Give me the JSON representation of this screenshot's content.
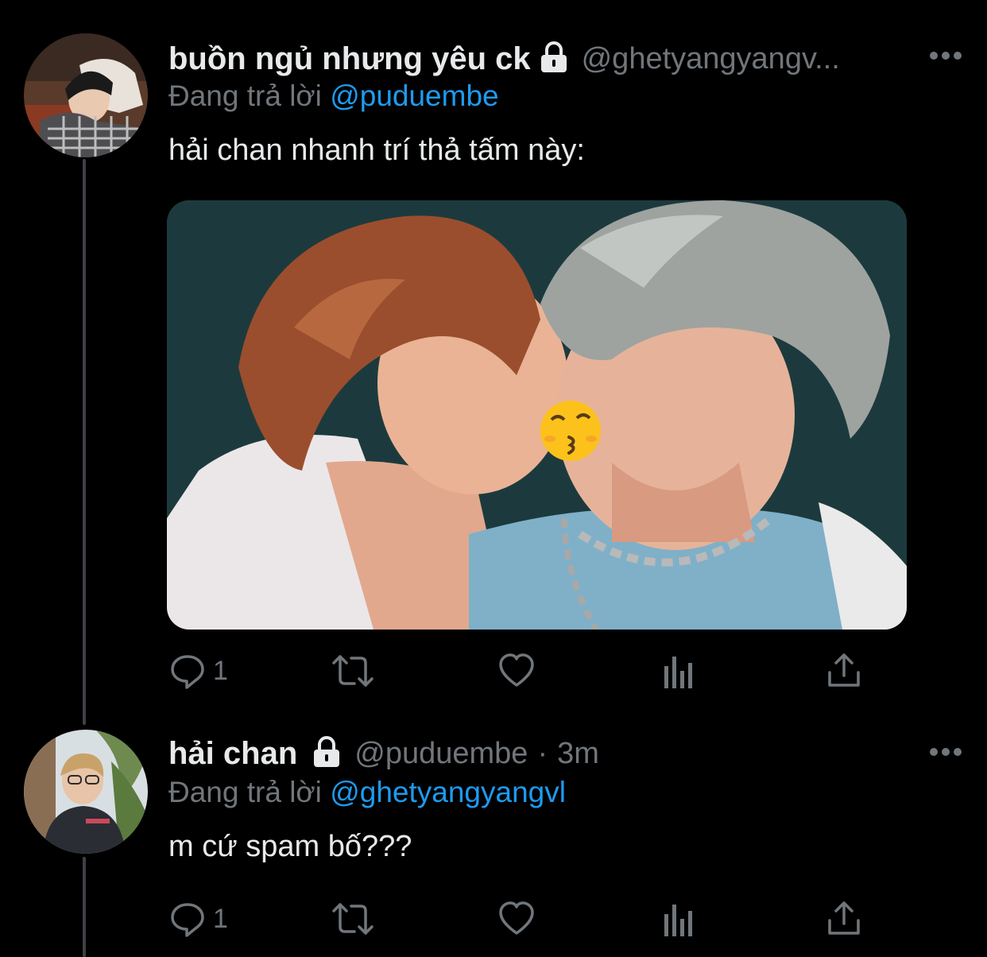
{
  "colors": {
    "background": "#000000",
    "text_primary": "#e7e9ea",
    "text_secondary": "#71767b",
    "link": "#1d9bf0",
    "thread_line": "#3e4144"
  },
  "tweets": [
    {
      "display_name": "buồn ngủ nhưng yêu ck",
      "handle": "@ghetyangyangv...",
      "protected_icon": "lock-icon",
      "replying_prefix": "Đang trả lời",
      "replying_to": "@puduembe",
      "text": "hải chan nhanh trí thả tấm này:",
      "has_media": true,
      "media_emoji": "😚",
      "actions": {
        "reply_count": "1",
        "retweet_count": "",
        "like_count": ""
      }
    },
    {
      "display_name": "hải chan",
      "handle": "@puduembe",
      "separator": "·",
      "timestamp": "3m",
      "protected_icon": "lock-icon",
      "replying_prefix": "Đang trả lời",
      "replying_to": "@ghetyangyangvl",
      "text": "m cứ spam bố???",
      "has_media": false,
      "actions": {
        "reply_count": "1",
        "retweet_count": "",
        "like_count": ""
      }
    }
  ]
}
